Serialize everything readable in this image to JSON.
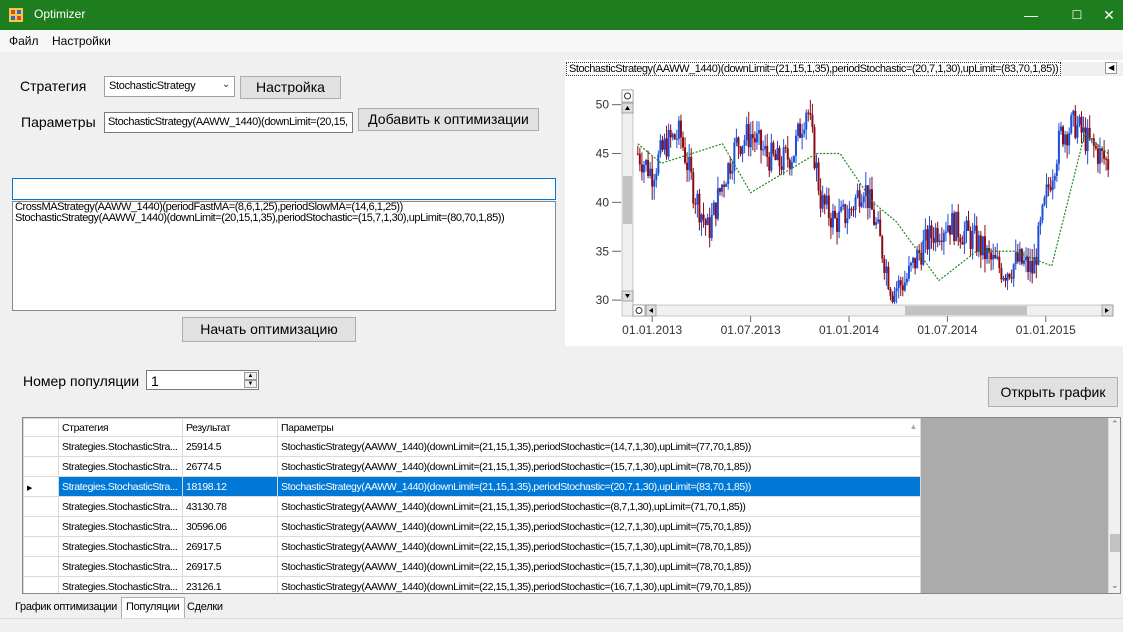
{
  "window": {
    "title": "Optimizer",
    "minimize": "—",
    "maximize": "☐",
    "close": "✕"
  },
  "menu": {
    "file": "Файл",
    "settings": "Настройки"
  },
  "strategy": {
    "label": "Стратегия",
    "value": "StochasticStrategy",
    "settings_button": "Настройка"
  },
  "params": {
    "label": "Параметры",
    "value": "StochasticStrategy(AAWW_1440)(downLimit=(20,15,",
    "add_button": "Добавить к оптимизации"
  },
  "filter": {
    "value": ""
  },
  "strategy_list": [
    "CrossMAStrategy(AAWW_1440)(periodFastMA=(8,6,1,25),periodSlowMA=(14,6,1,25))",
    "StochasticStrategy(AAWW_1440)(downLimit=(20,15,1,35),periodStochastic=(15,7,1,30),upLimit=(80,70,1,85))"
  ],
  "start_button": "Начать оптимизацию",
  "chart": {
    "caption": "StochasticStrategy(AAWW_1440)(downLimit=(21,15,1,35),periodStochastic=(20,7,1,30),upLimit=(83,70,1,85))",
    "colors": {
      "up": "#1c4fd8",
      "down": "#8b0a14",
      "trend": "#1e8a1e"
    }
  },
  "chart_data": {
    "type": "line",
    "title": "",
    "x_tick_labels": [
      "01.01.2013",
      "01.07.2013",
      "01.01.2014",
      "01.07.2014",
      "01.01.2015"
    ],
    "y_ticks": [
      30,
      35,
      40,
      45,
      50
    ],
    "ylim": [
      29.5,
      51.5
    ],
    "grid": false,
    "series": [
      {
        "kind": "candlestick",
        "x": [
          0.0,
          0.03,
          0.06,
          0.09,
          0.12,
          0.15,
          0.18,
          0.21,
          0.24,
          0.27,
          0.3,
          0.33,
          0.36,
          0.39,
          0.42,
          0.45,
          0.48,
          0.51,
          0.54,
          0.57,
          0.6,
          0.63,
          0.66,
          0.69,
          0.72,
          0.75,
          0.78,
          0.81,
          0.84,
          0.87,
          0.9,
          0.93,
          0.96,
          1.0
        ],
        "y": [
          45,
          43,
          46,
          47,
          41,
          37,
          42,
          46,
          47,
          45,
          44,
          45,
          50,
          40,
          38,
          39,
          42,
          37,
          31,
          32,
          35,
          37,
          38,
          37,
          36,
          34,
          33,
          34,
          33,
          41,
          47,
          48,
          46,
          44
        ]
      },
      {
        "kind": "trend",
        "x": [
          0.0,
          0.05,
          0.18,
          0.24,
          0.38,
          0.43,
          0.5,
          0.55,
          0.64,
          0.72,
          0.8,
          0.88,
          0.95,
          1.0
        ],
        "y": [
          46,
          44,
          46,
          41,
          45,
          45,
          40,
          38,
          32,
          35,
          35,
          33.5,
          47,
          45
        ]
      }
    ]
  },
  "population": {
    "label": "Номер популяции",
    "value": "1"
  },
  "open_chart_button": "Открыть график",
  "grid": {
    "columns": [
      "Стратегия",
      "Результат",
      "Параметры"
    ],
    "rows": [
      {
        "strategy": "Strategies.StochasticStra...",
        "result": "25914.5",
        "params": "StochasticStrategy(AAWW_1440)(downLimit=(21,15,1,35),periodStochastic=(14,7,1,30),upLimit=(77,70,1,85))"
      },
      {
        "strategy": "Strategies.StochasticStra...",
        "result": "26774.5",
        "params": "StochasticStrategy(AAWW_1440)(downLimit=(21,15,1,35),periodStochastic=(15,7,1,30),upLimit=(78,70,1,85))"
      },
      {
        "strategy": "Strategies.StochasticStra...",
        "result": "18198.12",
        "params": "StochasticStrategy(AAWW_1440)(downLimit=(21,15,1,35),periodStochastic=(20,7,1,30),upLimit=(83,70,1,85))"
      },
      {
        "strategy": "Strategies.StochasticStra...",
        "result": "43130.78",
        "params": "StochasticStrategy(AAWW_1440)(downLimit=(21,15,1,35),periodStochastic=(8,7,1,30),upLimit=(71,70,1,85))"
      },
      {
        "strategy": "Strategies.StochasticStra...",
        "result": "30596.06",
        "params": "StochasticStrategy(AAWW_1440)(downLimit=(22,15,1,35),periodStochastic=(12,7,1,30),upLimit=(75,70,1,85))"
      },
      {
        "strategy": "Strategies.StochasticStra...",
        "result": "26917.5",
        "params": "StochasticStrategy(AAWW_1440)(downLimit=(22,15,1,35),periodStochastic=(15,7,1,30),upLimit=(78,70,1,85))"
      },
      {
        "strategy": "Strategies.StochasticStra...",
        "result": "26917.5",
        "params": "StochasticStrategy(AAWW_1440)(downLimit=(22,15,1,35),periodStochastic=(15,7,1,30),upLimit=(78,70,1,85))"
      },
      {
        "strategy": "Strategies.StochasticStra...",
        "result": "23126.1",
        "params": "StochasticStrategy(AAWW_1440)(downLimit=(22,15,1,35),periodStochastic=(16,7,1,30),upLimit=(79,70,1,85))"
      }
    ],
    "selected_row": 2
  },
  "tabs": [
    "График оптимизации",
    "Популяции",
    "Сделки"
  ],
  "active_tab": 1
}
